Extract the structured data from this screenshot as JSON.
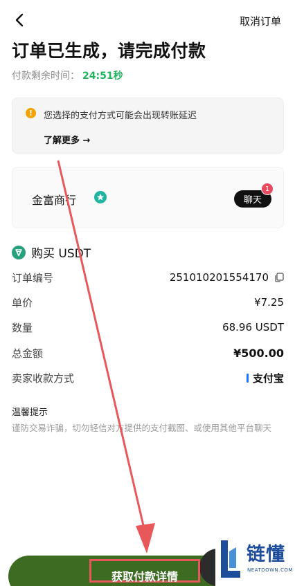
{
  "header": {
    "cancel_label": "取消订单"
  },
  "title": "订单已生成，请完成付款",
  "countdown": {
    "label": "付款剩余时间：",
    "time": "24:51秒"
  },
  "notice": {
    "text": "您选择的支付方式可能会出现转账延迟",
    "learn_more": "了解更多 →"
  },
  "merchant": {
    "name": "金富商行",
    "chat_label": "聊天",
    "unread_count": "1"
  },
  "order": {
    "title": "购买 USDT",
    "rows": [
      {
        "label": "订单编号",
        "value": "251010201554170"
      },
      {
        "label": "单价",
        "value": "¥7.25"
      },
      {
        "label": "数量",
        "value": "68.96 USDT"
      },
      {
        "label": "总金额",
        "value": "¥500.00"
      },
      {
        "label": "卖家收款方式",
        "value": "支付宝"
      }
    ]
  },
  "tips": {
    "title": "温馨提示",
    "text": "谨防交易诈骗，切勿轻信对方提供的支付截图、或使用其他平台聊天"
  },
  "action": {
    "label": "获取付款详情"
  },
  "watermark": {
    "brand": "链懂",
    "site": "NEATDOWN.COM"
  },
  "colors": {
    "countdown": "#22b35e",
    "primary_button": "#3c6b21",
    "annotation": "#e8585a",
    "usdt": "#26a17b"
  }
}
